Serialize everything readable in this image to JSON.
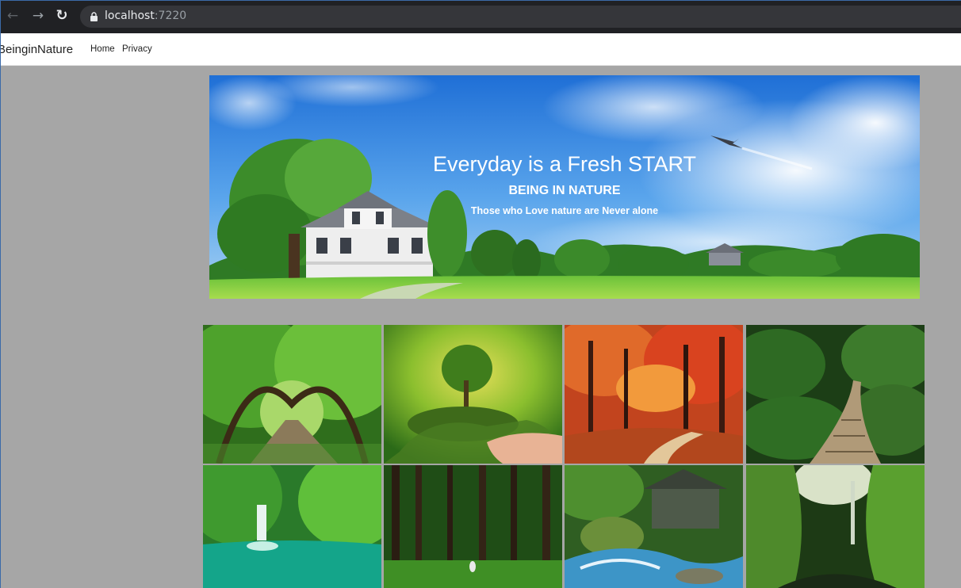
{
  "browser": {
    "url_host": "localhost",
    "url_port": ":7220"
  },
  "navbar": {
    "brand": "BeinginNature",
    "links": [
      "Home",
      "Privacy"
    ]
  },
  "hero": {
    "title": "Everyday is a Fresh START",
    "subtitle": "BEING IN NATURE",
    "tagline": "Those who Love nature are Never alone"
  },
  "gallery": {
    "images": [
      "green-tunnel-road",
      "tree-on-hand",
      "autumn-forest-path",
      "tropical-boardwalk",
      "green-waterfall-pool",
      "pine-forest",
      "mill-stream",
      "mossy-canyon"
    ]
  }
}
